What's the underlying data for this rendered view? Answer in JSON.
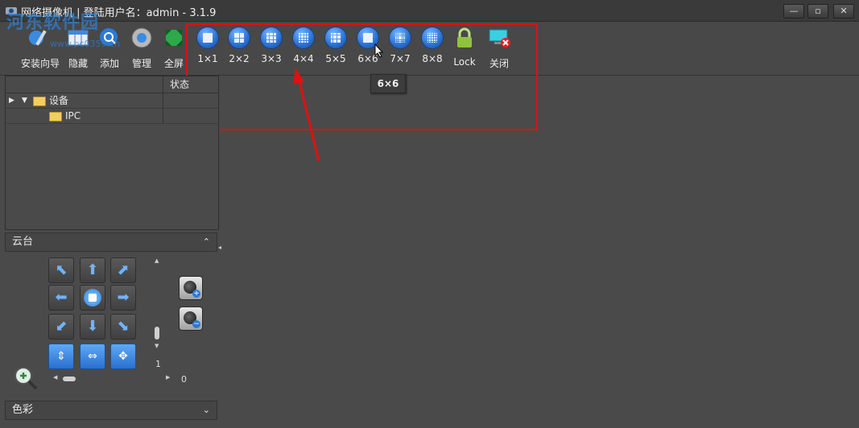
{
  "window": {
    "title": "网络摄像机 | 登陆用户名：admin - 3.1.9",
    "minimize": "—",
    "maximize": "▫",
    "close": "✕"
  },
  "watermark": {
    "text": "河东软件园",
    "sub": "www.pc0359.cn"
  },
  "toolbar": {
    "items": [
      {
        "label": "安装向导",
        "icon": "wizard-icon"
      },
      {
        "label": "隐藏",
        "icon": "hide-icon"
      },
      {
        "label": "添加",
        "icon": "add-search-icon"
      },
      {
        "label": "管理",
        "icon": "gear-icon"
      },
      {
        "label": "全屏",
        "icon": "fullscreen-icon"
      }
    ],
    "layouts": [
      {
        "label": "1×1",
        "n": 1
      },
      {
        "label": "2×2",
        "n": 2
      },
      {
        "label": "3×3",
        "n": 3
      },
      {
        "label": "4×4",
        "n": 4
      },
      {
        "label": "5×5",
        "n": 5
      },
      {
        "label": "6×6",
        "n": 6
      },
      {
        "label": "7×7",
        "n": 7
      },
      {
        "label": "8×8",
        "n": 8
      }
    ],
    "lock_label": "Lock",
    "close_label": "关闭"
  },
  "tooltip": {
    "text": "6×6"
  },
  "device_tree": {
    "status_header": "状态",
    "root": "设备",
    "child": "IPC"
  },
  "ptz": {
    "title": "云台",
    "scroll_value": "1",
    "hscroll_value": "0"
  },
  "color_section": {
    "title": "色彩"
  },
  "colors": {
    "accent": "#2a6fd0",
    "highlight": "#e01010",
    "bg": "#4a4a4a"
  }
}
